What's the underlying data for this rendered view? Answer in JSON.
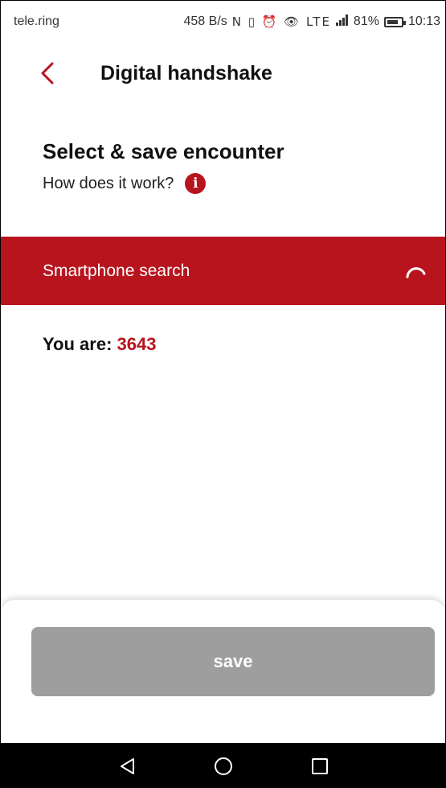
{
  "status_bar": {
    "carrier": "tele.ring",
    "speed": "458 B/s",
    "icons": "N ▯ ⏰ 👁 LTE",
    "battery_percent": "81%",
    "battery_level": 0.81,
    "time": "10:13"
  },
  "header": {
    "title": "Digital handshake",
    "back_icon": "chevron-left-icon"
  },
  "section": {
    "title": "Select & save encounter",
    "help_text": "How does it work?",
    "info_icon": "i"
  },
  "banner": {
    "label": "Smartphone search",
    "spinner_icon": "loading-spinner-icon"
  },
  "identity": {
    "label": "You are:",
    "code": "3643"
  },
  "actions": {
    "save_label": "save"
  },
  "colors": {
    "accent": "#b8141e",
    "button_disabled": "#9e9e9e",
    "navbar": "#000000"
  },
  "navbar": {
    "back_icon": "triangle-back-icon",
    "home_icon": "circle-home-icon",
    "recents_icon": "square-recents-icon"
  }
}
